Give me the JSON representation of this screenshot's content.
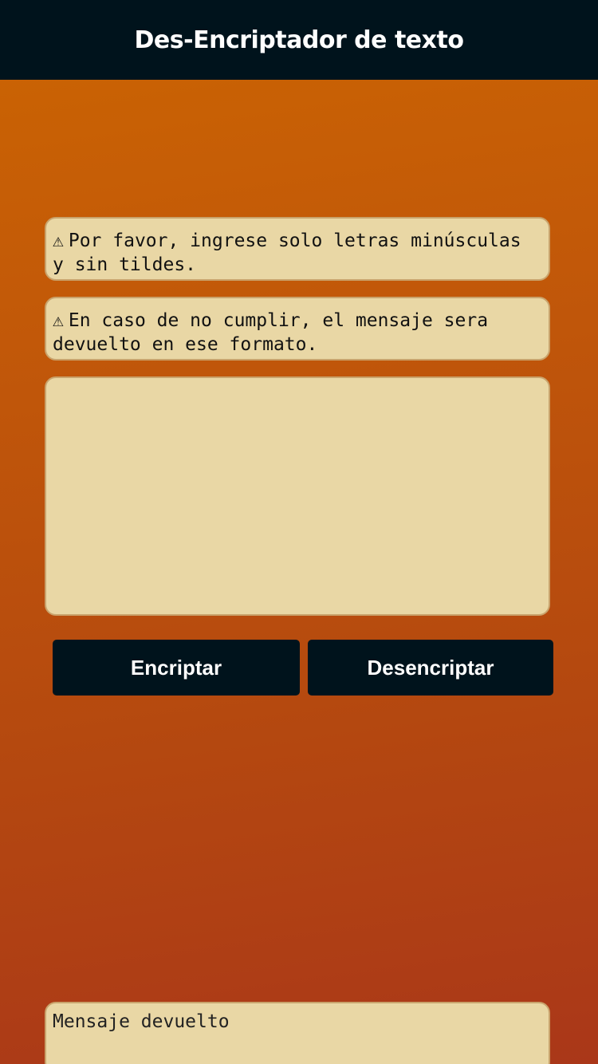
{
  "header": {
    "title": "Des-Encriptador de texto"
  },
  "notices": {
    "warn_icon": "⚠",
    "first": "Por favor, ingrese solo letras minúsculas y sin tildes.",
    "second": "En caso de no cumplir, el mensaje sera devuelto en ese formato."
  },
  "input": {
    "value": "",
    "placeholder": ""
  },
  "buttons": {
    "encrypt": "Encriptar",
    "decrypt": "Desencriptar"
  },
  "output": {
    "placeholder": "Mensaje devuelto"
  },
  "colors": {
    "header_bg": "#00131c",
    "box_bg": "#e9d7a5",
    "gradient_top": "#cc6502",
    "gradient_bottom": "#aa3719"
  }
}
